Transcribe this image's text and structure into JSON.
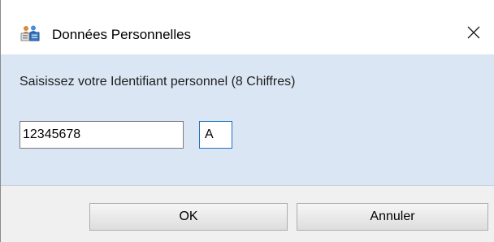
{
  "window": {
    "title": "Données Personnelles",
    "icon": "people-card-icon",
    "close_glyph": "✕"
  },
  "form": {
    "prompt": "Saisissez votre Identifiant personnel  (8 Chiffres)",
    "id_value": "12345678",
    "suffix_value": "A"
  },
  "buttons": {
    "ok_label": "OK",
    "cancel_label": "Annuler"
  },
  "colors": {
    "content_background": "#dbe6f4",
    "focus_border": "#1e73be"
  }
}
